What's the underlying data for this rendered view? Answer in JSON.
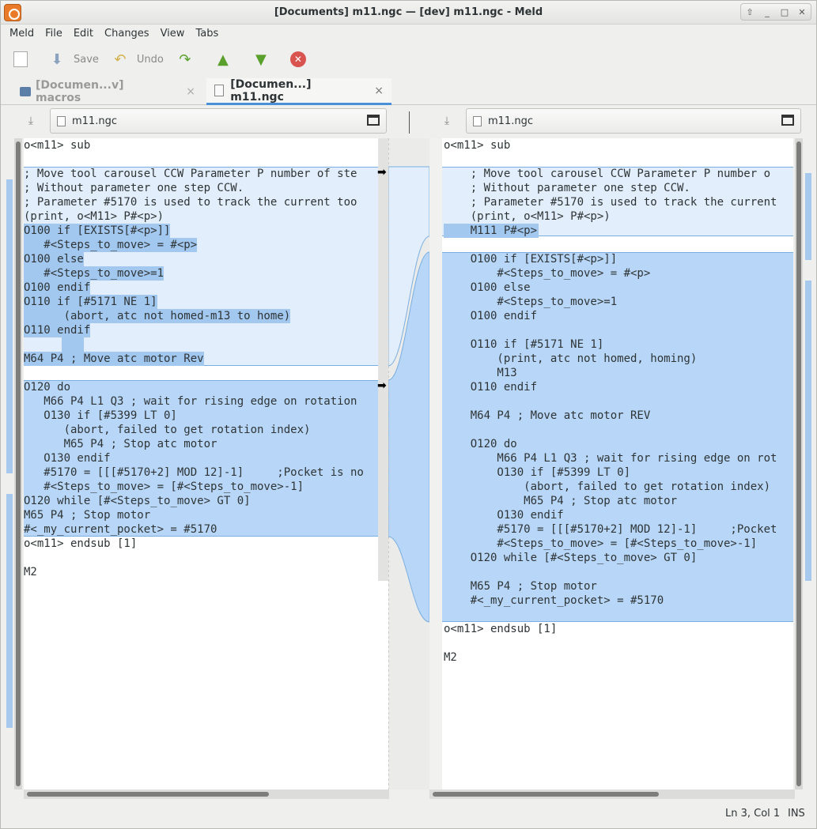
{
  "window": {
    "title": "[Documents] m11.ngc — [dev] m11.ngc - Meld"
  },
  "menu": [
    "Meld",
    "File",
    "Edit",
    "Changes",
    "View",
    "Tabs"
  ],
  "toolbar": {
    "save_label": "Save",
    "undo_label": "Undo"
  },
  "tabs": [
    {
      "label": "[Documen...v] macros",
      "close": "×"
    },
    {
      "label": "[Documen...] m11.ngc",
      "close": "×"
    }
  ],
  "left": {
    "filename": "m11.ngc",
    "lines": [
      "o<m11> sub",
      "",
      "; Move tool carousel CCW Parameter P number of ste",
      "; Without parameter one step CCW.",
      "; Parameter #5170 is used to track the current too",
      "(print, o<M11> P#<p>)",
      "O100 if [EXISTS[#<p>]]",
      "   #<Steps_to_move> = #<p>",
      "O100 else",
      "   #<Steps_to_move>=1",
      "O100 endif",
      "O110 if [#5171 NE 1]",
      "      (abort, atc not homed-m13 to home)",
      "O110 endif",
      "",
      "M64 P4 ; Move atc motor Rev",
      "",
      "O120 do",
      "   M66 P4 L1 Q3 ; wait for rising edge on rotation",
      "   O130 if [#5399 LT 0]",
      "      (abort, failed to get rotation index)",
      "      M65 P4 ; Stop atc motor",
      "   O130 endif",
      "   #5170 = [[[#5170+2] MOD 12]-1]     ;Pocket is no",
      "   #<Steps_to_move> = [#<Steps_to_move>-1]",
      "O120 while [#<Steps_to_move> GT 0]",
      "M65 P4 ; Stop motor",
      "#<_my_current_pocket> = #5170",
      "o<m11> endsub [1]",
      "",
      "M2"
    ]
  },
  "right": {
    "filename": "m11.ngc",
    "lines": [
      "o<m11> sub",
      "",
      "    ; Move tool carousel CCW Parameter P number o",
      "    ; Without parameter one step CCW.",
      "    ; Parameter #5170 is used to track the current",
      "    (print, o<M11> P#<p>)",
      "    M111 P#<p>",
      "",
      "    O100 if [EXISTS[#<p>]]",
      "        #<Steps_to_move> = #<p>",
      "    O100 else",
      "        #<Steps_to_move>=1",
      "    O100 endif",
      "",
      "    O110 if [#5171 NE 1]",
      "        (print, atc not homed, homing)",
      "        M13",
      "    O110 endif",
      "",
      "    M64 P4 ; Move atc motor REV",
      "",
      "    O120 do",
      "        M66 P4 L1 Q3 ; wait for rising edge on rot",
      "        O130 if [#5399 LT 0]",
      "            (abort, failed to get rotation index)",
      "            M65 P4 ; Stop atc motor",
      "        O130 endif",
      "        #5170 = [[[#5170+2] MOD 12]-1]     ;Pocket",
      "        #<Steps_to_move> = [#<Steps_to_move>-1]",
      "    O120 while [#<Steps_to_move> GT 0]",
      "",
      "    M65 P4 ; Stop motor",
      "    #<_my_current_pocket> = #5170",
      "o<m11> endsub [1]",
      "",
      "M2"
    ]
  },
  "status": {
    "position": "Ln 3, Col 1",
    "mode": "INS"
  }
}
